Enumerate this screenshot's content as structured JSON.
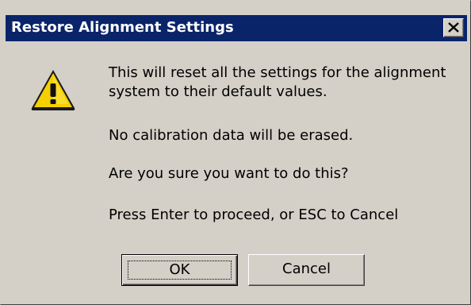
{
  "window": {
    "title": "Restore Alignment Settings",
    "close_icon": "close-x-icon"
  },
  "dialog": {
    "icon": "warning-icon",
    "message_line_1": "This will reset all the settings for the alignment",
    "message_line_2": "system to their default values.",
    "message_line_3": "No calibration data will be erased.",
    "message_line_4": "Are you sure you want to do this?",
    "message_line_5": "Press Enter to proceed, or ESC to Cancel"
  },
  "buttons": {
    "ok_label": "OK",
    "cancel_label": "Cancel"
  },
  "colors": {
    "titlebar": "#0a246a",
    "face": "#d4d0c8",
    "warning_fill": "#f5d000"
  }
}
